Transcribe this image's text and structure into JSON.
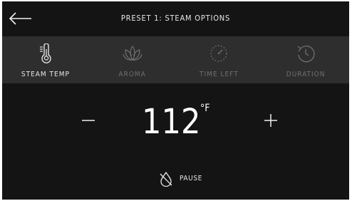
{
  "header": {
    "title": "PRESET 1: STEAM OPTIONS",
    "back_icon": "arrow-left-icon"
  },
  "tabs": [
    {
      "label": "STEAM TEMP",
      "icon": "thermometer-icon",
      "active": true
    },
    {
      "label": "AROMA",
      "icon": "lotus-icon",
      "active": false
    },
    {
      "label": "TIME LEFT",
      "icon": "gauge-icon",
      "active": false
    },
    {
      "label": "DURATION",
      "icon": "history-clock-icon",
      "active": false
    }
  ],
  "temperature": {
    "value": "112",
    "unit": "°F",
    "decrease_label": "−",
    "increase_label": "+"
  },
  "pause": {
    "label": "PAUSE",
    "icon": "drop-off-icon"
  },
  "colors": {
    "background": "#141414",
    "tab_bar": "#2e2e2e",
    "active_text": "#e6e6e6",
    "inactive_text": "#6f6f6f"
  }
}
